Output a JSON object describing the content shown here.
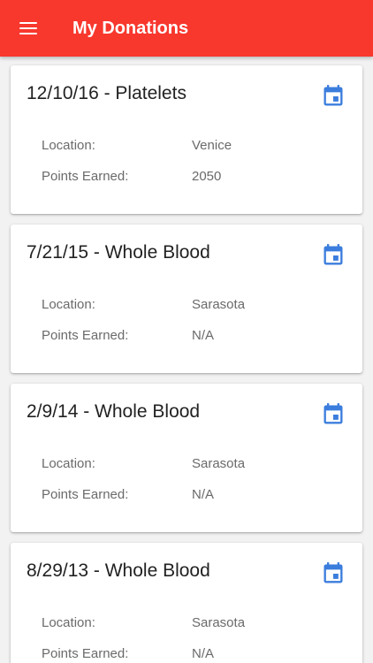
{
  "header": {
    "title": "My Donations",
    "menu_icon": "hamburger-menu-icon",
    "background_color": "#f8372d"
  },
  "labels": {
    "location": "Location:",
    "points": "Points Earned:"
  },
  "accent_color": "#3b7ddd",
  "calendar_icon": "calendar-icon",
  "donations": [
    {
      "title": "12/10/16 - Platelets",
      "location": "Venice",
      "points": "2050"
    },
    {
      "title": "7/21/15 - Whole Blood",
      "location": "Sarasota",
      "points": "N/A"
    },
    {
      "title": "2/9/14 - Whole Blood",
      "location": "Sarasota",
      "points": "N/A"
    },
    {
      "title": "8/29/13 - Whole Blood",
      "location": "Sarasota",
      "points": "N/A"
    }
  ]
}
